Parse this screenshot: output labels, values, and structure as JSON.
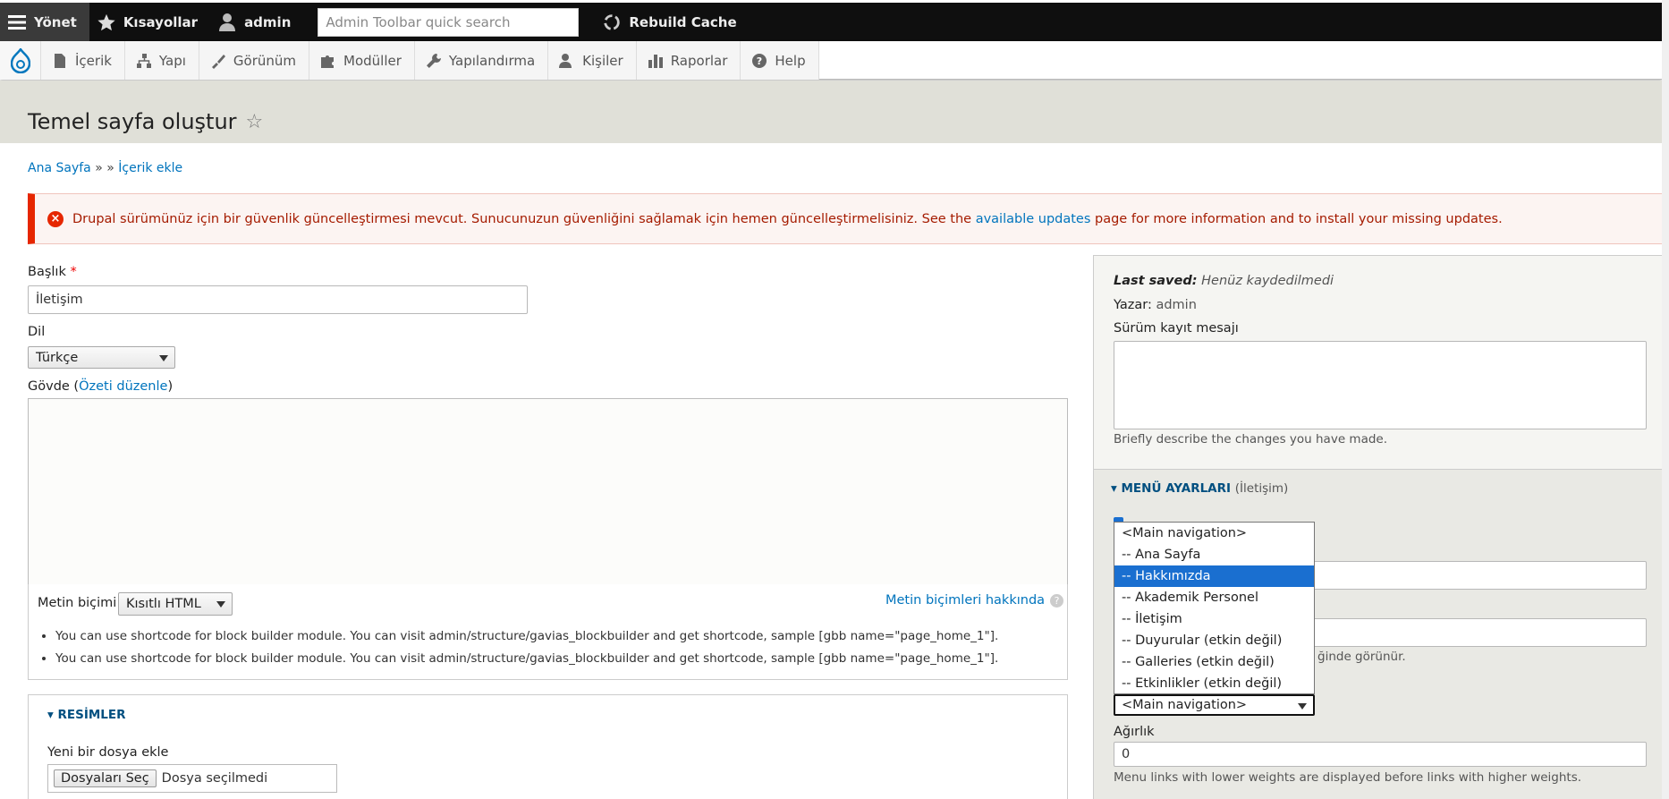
{
  "toolbar": {
    "manage": "Yönet",
    "shortcuts": "Kısayollar",
    "user": "admin",
    "search_placeholder": "Admin Toolbar quick search",
    "rebuild": "Rebuild Cache"
  },
  "tray": {
    "items": [
      {
        "label": "İçerik",
        "icon": "file-icon"
      },
      {
        "label": "Yapı",
        "icon": "structure-icon"
      },
      {
        "label": "Görünüm",
        "icon": "paint-brush-icon"
      },
      {
        "label": "Modüller",
        "icon": "puzzle-icon"
      },
      {
        "label": "Yapılandırma",
        "icon": "wrench-icon"
      },
      {
        "label": "Kişiler",
        "icon": "people-icon"
      },
      {
        "label": "Raporlar",
        "icon": "bar-chart-icon"
      },
      {
        "label": "Help",
        "icon": "help-icon"
      }
    ]
  },
  "page": {
    "title": "Temel sayfa oluştur"
  },
  "breadcrumb": {
    "home": "Ana Sayfa",
    "sep": "» »",
    "add": "İçerik ekle"
  },
  "alert": {
    "text": "Drupal sürümünüz için bir güvenlik güncelleştirmesi mevcut. Sunucunuzun güvenliğini sağlamak için hemen güncelleştirmelisiniz. See the",
    "link": "available updates",
    "after": "page for more information and to install your missing updates."
  },
  "form": {
    "title_label": "Başlık",
    "required_mark": "*",
    "title_value": "İletişim",
    "lang_label": "Dil",
    "lang_value": "Türkçe",
    "body_label": "Gövde (",
    "body_summary_link": "Özeti düzenle",
    "body_label_close": ")",
    "format_label": "Metin biçimi",
    "format_value": "Kısıtlı HTML",
    "format_help": "Metin biçimleri hakkında",
    "tips": [
      "You can use shortcode for block builder module. You can visit admin/structure/gavias_blockbuilder and get shortcode, sample [gbb name=\"page_home_1\"].",
      "You can use shortcode for block builder module. You can visit admin/structure/gavias_blockbuilder and get shortcode, sample [gbb name=\"page_home_1\"]."
    ],
    "images_title": "RESİMLER",
    "add_file_label": "Yeni bir dosya ekle",
    "file_button": "Dosyaları Seç",
    "file_status": "Dosya seçilmedi"
  },
  "sidebar": {
    "last_saved_label": "Last saved:",
    "last_saved_value": "Henüz kaydedilmedi",
    "author_label": "Yazar:",
    "author_value": "admin",
    "revision_label": "Sürüm kayıt mesajı",
    "revision_desc": "Briefly describe the changes you have made.",
    "menu_title": "MENÜ AYARLARI",
    "menu_subtitle": "(İletişim)",
    "partial_desc": "ğinde görünür.",
    "parent_selected": "<Main navigation>",
    "parent_options": [
      "<Main navigation>",
      "-- Ana Sayfa",
      "-- Hakkımızda",
      "-- Akademik Personel",
      "-- İletişim",
      "-- Duyurular (etkin değil)",
      "-- Galleries (etkin değil)",
      "-- Etkinlikler (etkin değil)"
    ],
    "highlighted_option": "-- Hakkımızda",
    "weight_label": "Ağırlık",
    "weight_value": "0",
    "weight_desc": "Menu links with lower weights are displayed before links with higher weights."
  },
  "colors": {
    "toolbar_bg": "#0f0f0f",
    "link": "#0074bd",
    "error": "#e62600",
    "highlight": "#1a6fd0"
  }
}
